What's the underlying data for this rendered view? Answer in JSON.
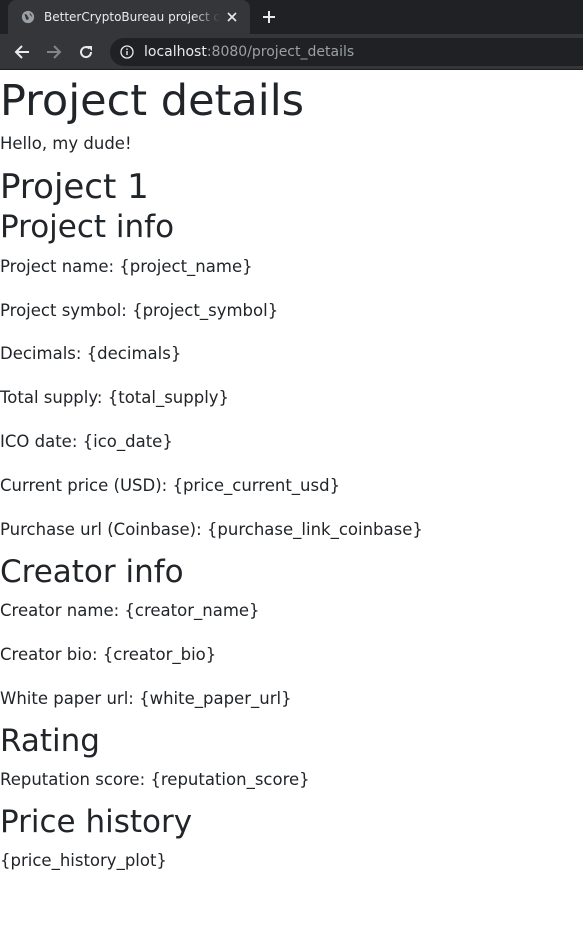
{
  "browser": {
    "tab_title": "BetterCryptoBureau project details",
    "tab_favicon": "globe-icon",
    "url_host": "localhost",
    "url_rest": ":8080/project_details"
  },
  "page": {
    "title": "Project details",
    "greeting": "Hello, my dude!",
    "project_heading": "Project 1",
    "project_info": {
      "heading": "Project info",
      "fields": [
        "Project name: {project_name}",
        "Project symbol: {project_symbol}",
        "Decimals: {decimals}",
        "Total supply: {total_supply}",
        "ICO date: {ico_date}",
        "Current price (USD): {price_current_usd}",
        "Purchase url (Coinbase): {purchase_link_coinbase}"
      ]
    },
    "creator_info": {
      "heading": "Creator info",
      "fields": [
        "Creator name: {creator_name}",
        "Creator bio: {creator_bio}",
        "White paper url: {white_paper_url}"
      ]
    },
    "rating": {
      "heading": "Rating",
      "fields": [
        "Reputation score: {reputation_score}"
      ]
    },
    "price_history": {
      "heading": "Price history",
      "plot_placeholder": "{price_history_plot}"
    }
  }
}
